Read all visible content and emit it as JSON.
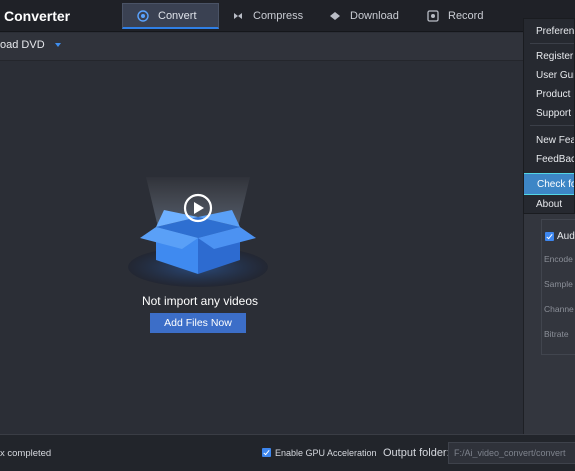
{
  "app": {
    "title": "Converter"
  },
  "tabs": [
    {
      "label": "Convert",
      "icon": "convert-icon",
      "active": true
    },
    {
      "label": "Compress",
      "icon": "compress-icon",
      "active": false
    },
    {
      "label": "Download",
      "icon": "download-icon",
      "active": false
    },
    {
      "label": "Record",
      "icon": "record-icon",
      "active": false
    }
  ],
  "toolbar": {
    "load_dvd_label": "oad DVD"
  },
  "main": {
    "empty_message": "Not import any videos",
    "add_files_label": "Add Files Now"
  },
  "menu": {
    "items": [
      {
        "label": "Preferenc"
      },
      {
        "label": "Register"
      },
      {
        "label": "User Gui"
      },
      {
        "label": "Product I"
      },
      {
        "label": "Support"
      },
      {
        "label": "New Feat"
      },
      {
        "label": "FeedBac"
      },
      {
        "label": "Check fo",
        "highlighted": true
      },
      {
        "label": "About"
      }
    ]
  },
  "audio_panel": {
    "audio_label": "Audi",
    "audio_checked": true,
    "fields": [
      "Encode",
      "Sample",
      "Channe",
      "Bitrate"
    ]
  },
  "status": {
    "text": "x completed",
    "gpu_label": "Enable GPU Acceleration",
    "gpu_checked": true,
    "output_label": "Output folder:",
    "output_value": "F:/Ai_video_convert/convert"
  },
  "colors": {
    "accent": "#3c6ec8",
    "highlight": "#3d86c6",
    "highlight_border": "#52d6e6",
    "background": "#2b2e36"
  }
}
